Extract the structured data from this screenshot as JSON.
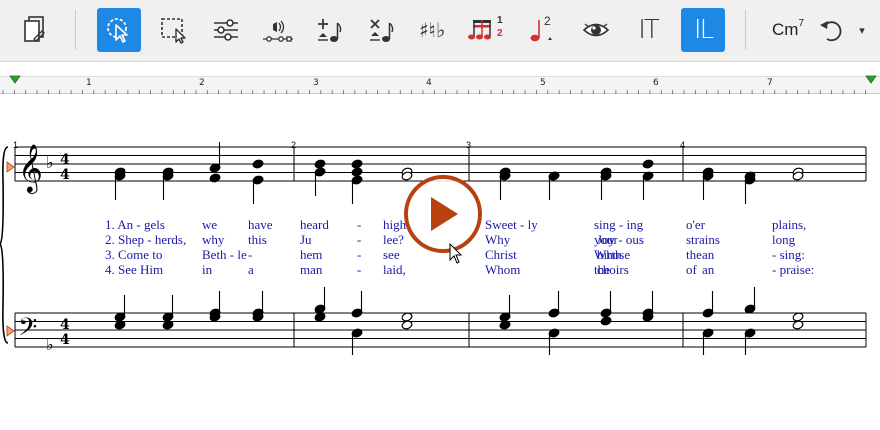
{
  "toolbar": {
    "chord_label": "Cm",
    "chord_sup": "7",
    "page_superscript": "2",
    "notes_sup": "1",
    "notes_sub": "2",
    "tool_text_label": "IT",
    "tool_lyrics_label": "IL",
    "dropdown_glyph": "▾"
  },
  "ruler": {
    "ticks": [
      "1",
      "2",
      "3",
      "4",
      "5",
      "6",
      "7"
    ]
  },
  "score": {
    "measure_numbers": [
      "1",
      "2",
      "3",
      "4"
    ],
    "lyrics": {
      "col1": [
        "1. An - gels",
        "2. Shep - herds,",
        "3. Come    to",
        "4. See    Him"
      ],
      "col2": [
        "we",
        "why",
        "Beth - le",
        "in"
      ],
      "col3": [
        "have",
        "this",
        "-",
        "a"
      ],
      "col4": [
        "heard",
        "Ju",
        "hem",
        "man"
      ],
      "col5": [
        "-",
        "-",
        "-",
        "-"
      ],
      "col6": [
        "high",
        "lee?",
        "see",
        "laid,"
      ],
      "col7": [
        "Sweet - ly",
        "Why",
        "Christ",
        "Whom"
      ],
      "col8": [
        "sing - ing",
        "your",
        "Whose",
        "the"
      ],
      "col9": [
        "",
        "Joy - ous",
        "birth",
        "choirs"
      ],
      "col10": [
        "o'er",
        "strains",
        "the",
        "of"
      ],
      "col11": [
        "",
        "",
        "an",
        "an"
      ],
      "col12": [
        "plains,",
        "long",
        "-    sing:",
        "-    praise:"
      ]
    }
  },
  "colors": {
    "accent": "#1e88e5",
    "lyric_text": "#1a1aa6",
    "play_ring": "#b8420f",
    "notes_red": "#d32f2f"
  }
}
